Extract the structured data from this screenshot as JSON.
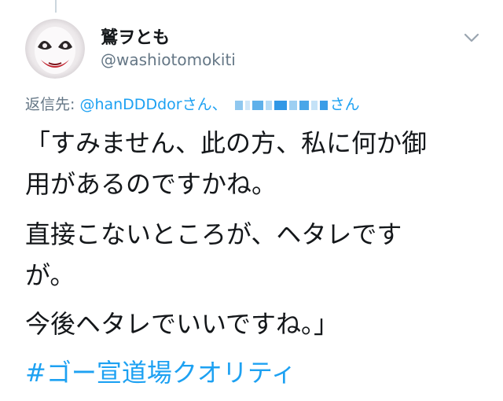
{
  "tweet": {
    "author": {
      "display_name": "鷲ヲとも",
      "handle": "@washiotomokiti",
      "avatar_icon": "joker-face-avatar"
    },
    "menu_icon": "chevron-down-icon",
    "reply_to": {
      "prefix": "返信先:",
      "mention_1": "@hanDDDdor",
      "suffix_1": "さん、",
      "suffix_2": "さん"
    },
    "body_lines": [
      "「すみません、此の方、私に何か御",
      "用があるのですかね。",
      "直接こないところが、ヘタレです",
      "が。",
      "今後ヘタレでいいですね。」"
    ],
    "hashtag": "#ゴー宣道場クオリティ"
  },
  "colors": {
    "text": "#14171a",
    "secondary": "#657786",
    "link": "#1da1f2",
    "divider": "#ccd6dd"
  }
}
